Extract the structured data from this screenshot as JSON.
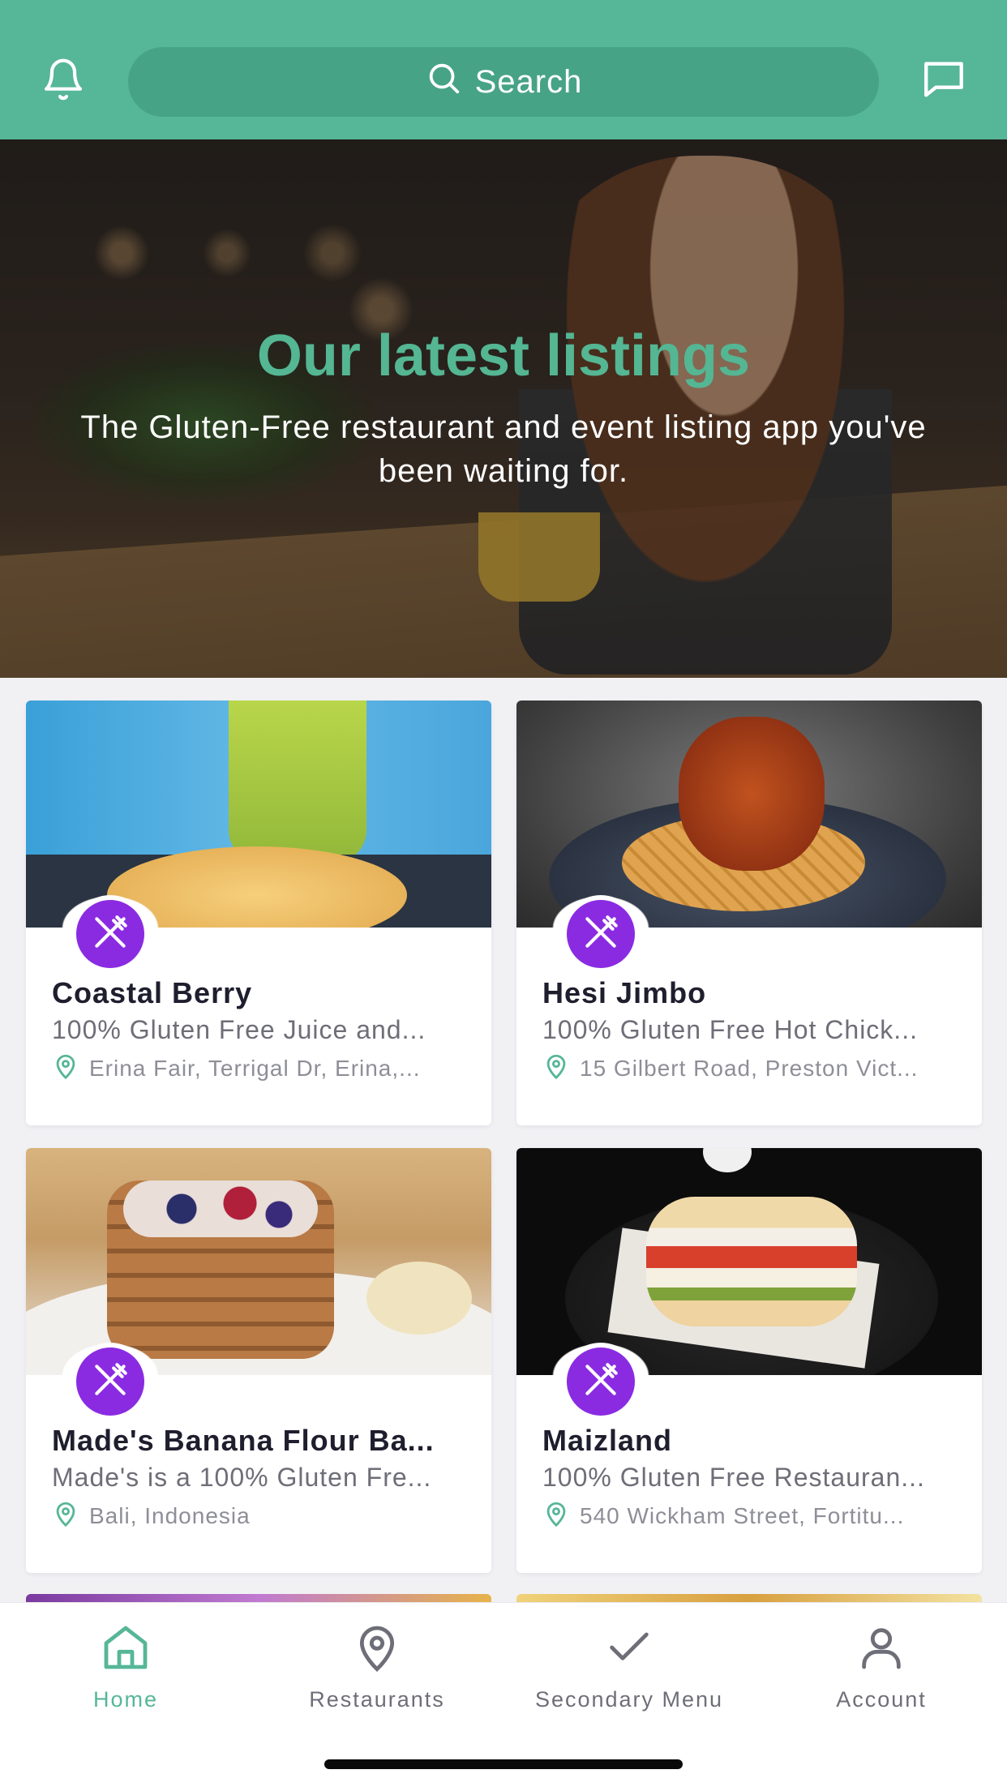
{
  "header": {
    "search_placeholder": "Search",
    "icons": [
      "bell-icon",
      "search-icon",
      "chat-icon"
    ],
    "background": "#56b698"
  },
  "hero": {
    "title": "Our latest listings",
    "subtitle": "The Gluten-Free restaurant and event listing app you've been waiting for."
  },
  "listings": [
    {
      "name": "Coastal Berry",
      "description": "100% Gluten Free Juice and...",
      "location": "Erina Fair, Terrigal Dr, Erina,..."
    },
    {
      "name": "Hesi Jimbo",
      "description": "100% Gluten Free Hot Chick...",
      "location": "15 Gilbert Road, Preston Vict..."
    },
    {
      "name": "Made's Banana Flour Ba...",
      "description": "Made's is a 100% Gluten Fre...",
      "location": "Bali, Indonesia"
    },
    {
      "name": "Maizland",
      "description": "100% Gluten Free Restauran...",
      "location": "540 Wickham Street, Fortitu..."
    }
  ],
  "tabbar": {
    "items": [
      {
        "label": "Home",
        "icon": "home-icon",
        "active": true
      },
      {
        "label": "Restaurants",
        "icon": "location-pin-icon",
        "active": false
      },
      {
        "label": "Secondary Menu",
        "icon": "checkmark-icon",
        "active": false
      },
      {
        "label": "Account",
        "icon": "user-icon",
        "active": false
      }
    ]
  },
  "colors": {
    "accent": "#56b698",
    "badge": "#8a2be2"
  }
}
